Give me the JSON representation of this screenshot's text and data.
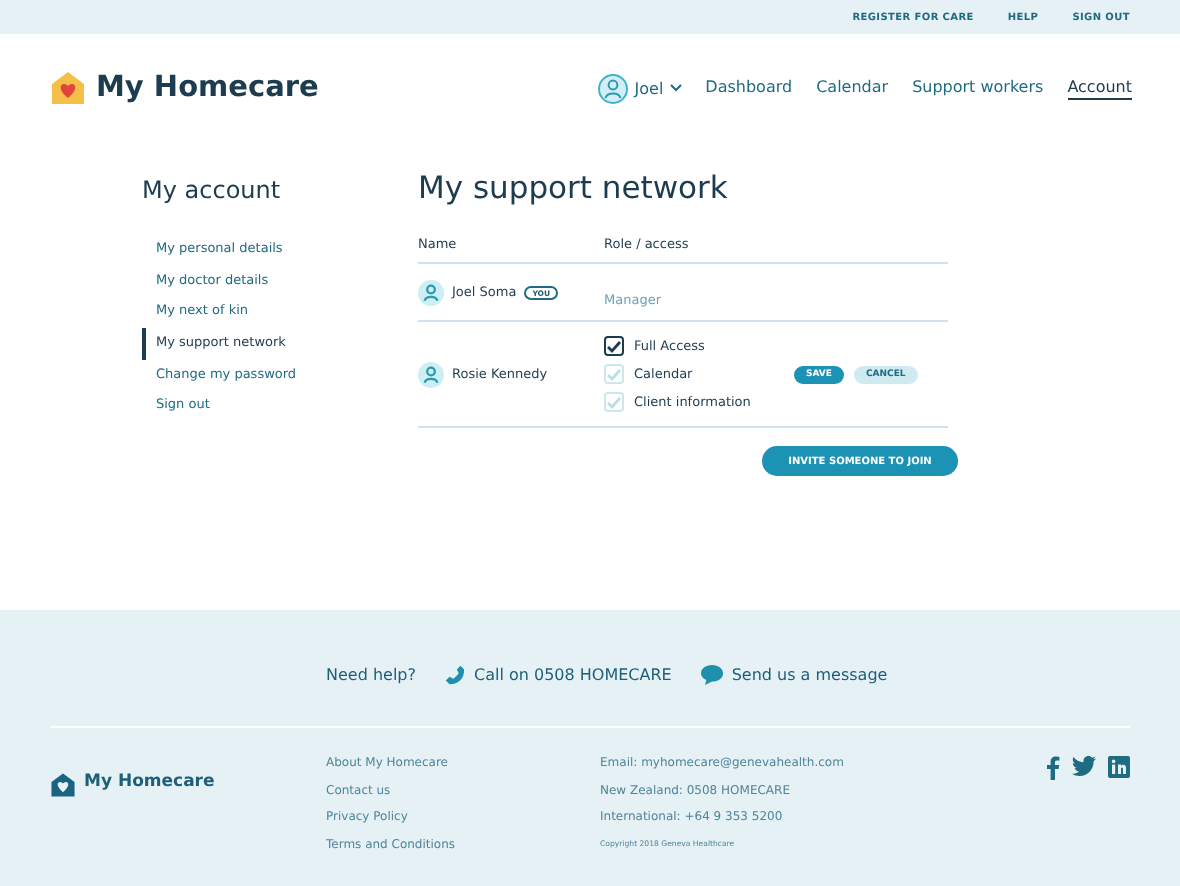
{
  "top_links": [
    "REGISTER FOR CARE",
    "HELP",
    "SIGN OUT"
  ],
  "brand": "My Homecare",
  "user": {
    "name": "Joel"
  },
  "nav": [
    {
      "label": "Dashboard",
      "selected": false
    },
    {
      "label": "Calendar",
      "selected": false
    },
    {
      "label": "Support workers",
      "selected": false
    },
    {
      "label": "Account",
      "selected": true
    }
  ],
  "sidebar": {
    "title": "My account",
    "items": [
      {
        "label": "My personal details",
        "selected": false
      },
      {
        "label": "My doctor details",
        "selected": false
      },
      {
        "label": "My next of kin",
        "selected": false
      },
      {
        "label": "My support network",
        "selected": true
      },
      {
        "label": "Change my password",
        "selected": false
      },
      {
        "label": "Sign out",
        "selected": false
      }
    ]
  },
  "page_title": "My support network",
  "table": {
    "columns": [
      "Name",
      "Role / access"
    ],
    "rows": [
      {
        "name": "Joel Soma",
        "badge": "YOU",
        "role": "Manager"
      },
      {
        "name": "Rosie Kennedy",
        "access": [
          {
            "label": "Full Access",
            "checked": true,
            "disabled": false
          },
          {
            "label": "Calendar",
            "checked": true,
            "disabled": true
          },
          {
            "label": "Client information",
            "checked": true,
            "disabled": true
          }
        ],
        "actions": [
          "SAVE",
          "CANCEL"
        ]
      }
    ]
  },
  "invite_button": "INVITE SOMEONE TO JOIN",
  "help": {
    "label": "Need help?",
    "call": "Call on 0508 HOMECARE",
    "message": "Send us a message"
  },
  "footer": {
    "brand": "My Homecare",
    "links": [
      "About My Homecare",
      "Contact us",
      "Privacy Policy",
      "Terms and Conditions"
    ],
    "contact": [
      "Email: myhomecare@genevahealth.com",
      "New Zealand: 0508 HOMECARE",
      "International: +64 9 353 5200"
    ],
    "copyright": "Copyright 2018 Geneva Healthcare"
  }
}
